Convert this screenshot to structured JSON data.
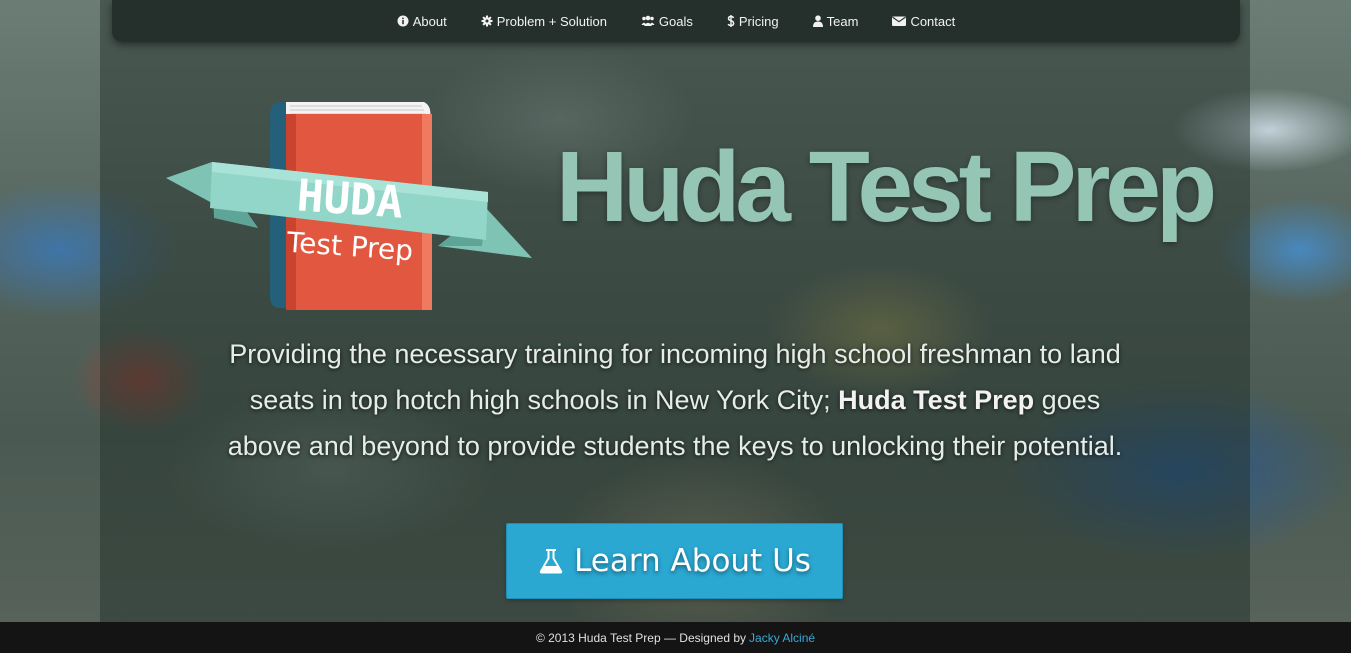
{
  "nav": {
    "items": [
      {
        "label": "About",
        "icon": "info-circle-icon"
      },
      {
        "label": "Problem + Solution",
        "icon": "gear-icon"
      },
      {
        "label": "Goals",
        "icon": "users-icon"
      },
      {
        "label": "Pricing",
        "icon": "dollar-icon"
      },
      {
        "label": "Team",
        "icon": "user-icon"
      },
      {
        "label": "Contact",
        "icon": "envelope-icon"
      }
    ]
  },
  "hero": {
    "title": "Huda Test Prep",
    "logo": {
      "word1": "HUDA",
      "word2": "Test Prep"
    },
    "tagline_part1": "Providing the necessary training for incoming high school freshman to land seats in top hotch high schools in New York City;",
    "tagline_bold": "Huda Test Prep",
    "tagline_part2": "goes above and beyond to provide students the keys to unlocking their potential.",
    "cta_label": "Learn About Us",
    "cta_icon": "flask-icon"
  },
  "footer": {
    "text": "© 2013 Huda Test Prep — Designed by",
    "link": "Jacky Alciné"
  },
  "colors": {
    "accent": "#2aa8d2",
    "title": "#95c5b4",
    "book_red": "#e2573f",
    "ribbon": "#8fd2c4",
    "footer_bg": "#141414",
    "link": "#36a9d6"
  }
}
